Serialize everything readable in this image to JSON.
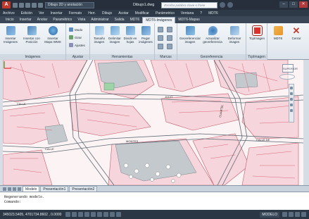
{
  "titlebar": {
    "app_logo": "A",
    "workspace": "Dibujo 2D y anotación",
    "doc_title": "Dibujo1.dwg",
    "search_placeholder": "Escriba palabra clave o frase",
    "controls": [
      "–",
      "□",
      "✕"
    ]
  },
  "menubar": {
    "items": [
      "Archivo",
      "Edición",
      "Ver",
      "Insertar",
      "Formato",
      "Herr.",
      "Dibujo",
      "Acotar",
      "Modificar",
      "Parámetrico",
      "Ventana",
      "?",
      "MDT6"
    ]
  },
  "ribbon_tabs": {
    "items": [
      "Inicio",
      "Insertar",
      "Anotar",
      "Paramétrico",
      "Vista",
      "Administrar",
      "Salida",
      "MDT6",
      "MDT6-Imágenes",
      "MDT6-Mapas"
    ],
    "active_index": 8
  },
  "ribbon": {
    "groups": {
      "imagenes": "Imágenes",
      "ajustar": "Ajustar",
      "herramientas": "Herramientas",
      "marcas": "Marcas",
      "georeferencia": "Georeferencia",
      "tcpimagen": "TcpImagen"
    },
    "buttons": {
      "insertar_imagenes": "Insertar Imágenes",
      "insertar_posicion": "Insertar con Posición",
      "insertar_wms": "Insertar Mapa WMS",
      "modo": "Modo",
      "girar": "Girar",
      "ajustes": "Ajustes",
      "tamano": "Tamaño imagen",
      "delimitar": "Delimitar imagen",
      "dividir": "Dividir en hojas",
      "pegar": "Pegar imágenes",
      "georeferenciar": "Georeferenciar imagen",
      "actualizar": "Actualizar georeferencia",
      "deformar": "Deformar imagen",
      "tcpimagen": "TcpImagen",
      "mdt6": "MDT6",
      "cerrar": "Cerrar"
    },
    "colors": {
      "tcpimagen": "#d9332b",
      "mdt6": "#e8942a",
      "cerrar": "#c0392b"
    }
  },
  "canvas": {
    "viewcube_label": "SUPERIOR",
    "street_labels": [
      "CALLE",
      "JULIO",
      "CALLE",
      "MONTES",
      "CALLE DE",
      "CUARTEL"
    ]
  },
  "layout_tabs": {
    "items": [
      "Modelo",
      "Presentación1",
      "Presentación2"
    ],
    "active_index": 0
  },
  "cmdline": {
    "lines": [
      "Regenerando modelo.",
      "Comando:"
    ]
  },
  "statusbar": {
    "coords": "345023.5405, 4701734.8602 , 0.0000",
    "model": "MODELO"
  }
}
